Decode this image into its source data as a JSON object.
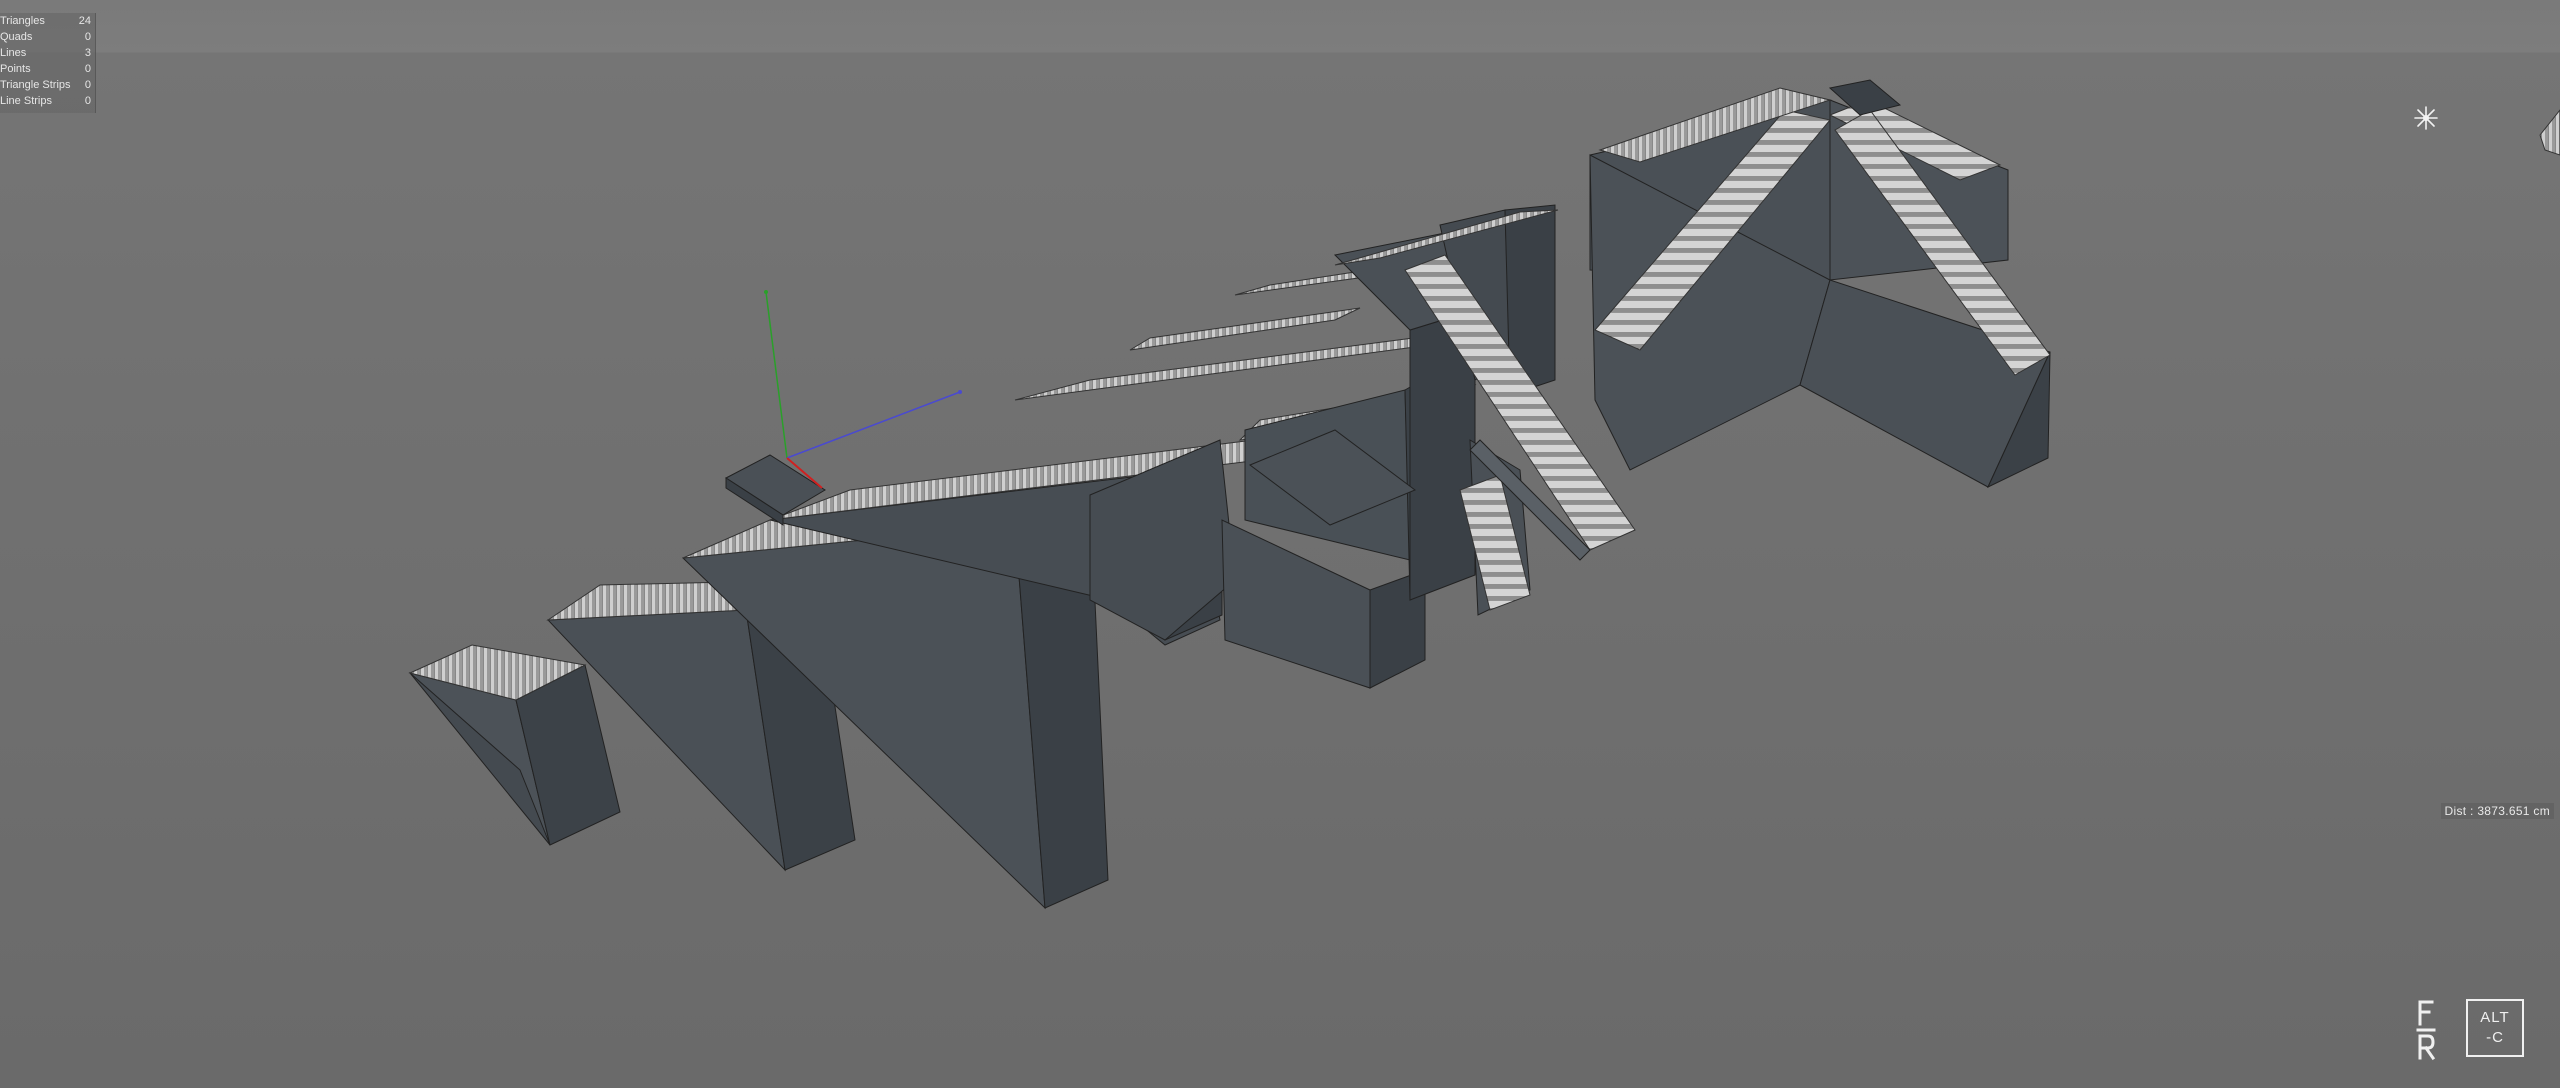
{
  "stats": {
    "rows": [
      {
        "label": "Triangles",
        "value": "24"
      },
      {
        "label": "Quads",
        "value": "0"
      },
      {
        "label": "Lines",
        "value": "3"
      },
      {
        "label": "Points",
        "value": "0"
      },
      {
        "label": "Triangle Strips",
        "value": "0"
      },
      {
        "label": "Line Strips",
        "value": "0"
      }
    ]
  },
  "viewport": {
    "distance": "Dist : 3873.651 cm",
    "light_icon": "light-icon"
  },
  "gizmo": {
    "x_color": "#d02020",
    "y_color": "#2aa02a",
    "z_color": "#4040c8"
  },
  "colors": {
    "background": "#6c6c6c",
    "block_front": "#4a5056",
    "block_side": "#3a4046",
    "step_light": "#d8d8d8"
  },
  "brand": {
    "left_mark": "F R",
    "right_line1": "ALT",
    "right_line2": "-C"
  }
}
